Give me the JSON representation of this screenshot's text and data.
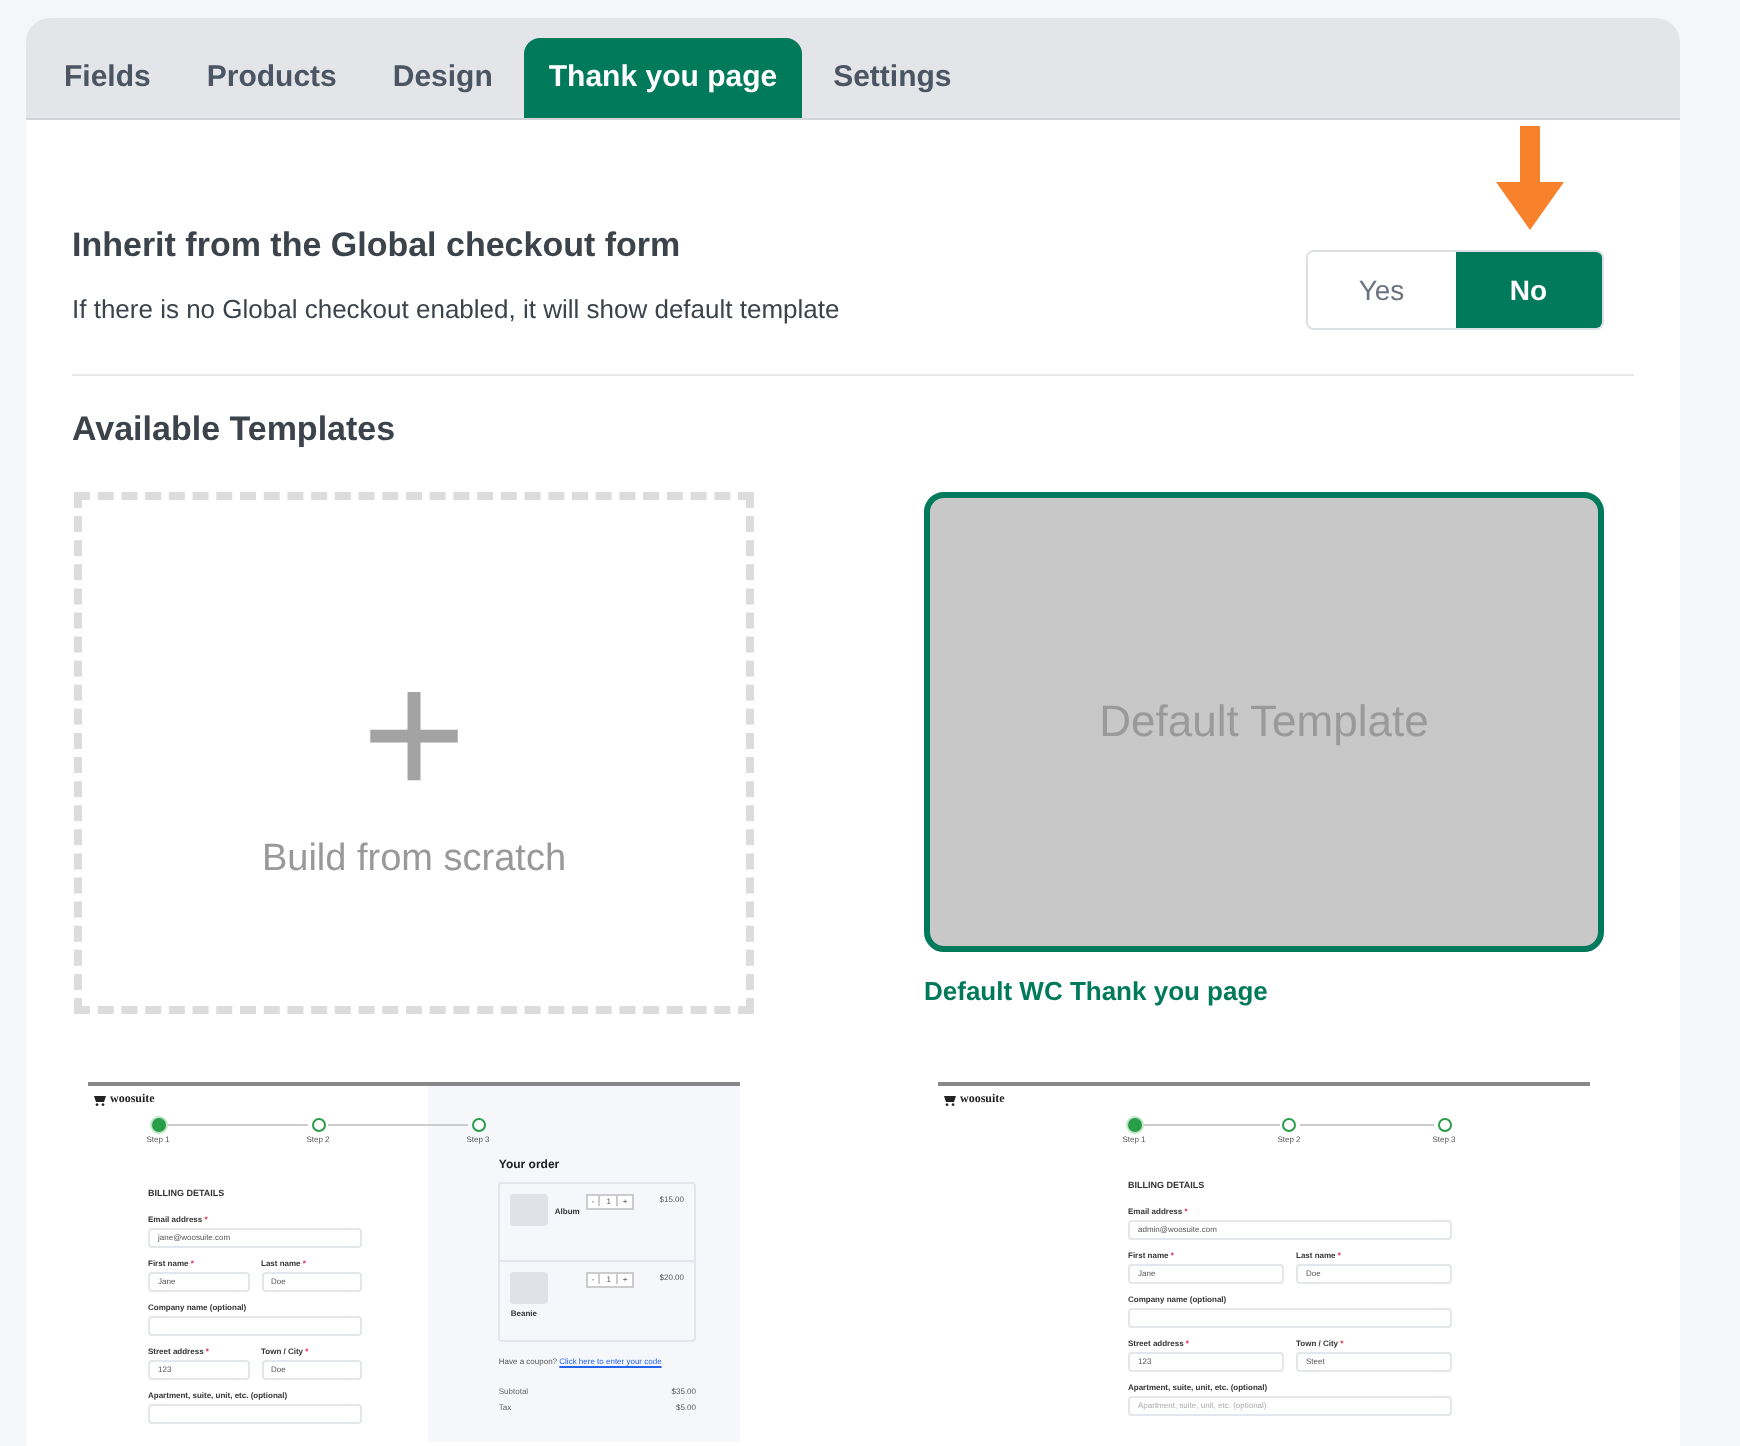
{
  "tabs": [
    {
      "label": "Fields",
      "selected": false
    },
    {
      "label": "Products",
      "selected": false
    },
    {
      "label": "Design",
      "selected": false
    },
    {
      "label": "Thank you page",
      "selected": true
    },
    {
      "label": "Settings",
      "selected": false
    }
  ],
  "inherit": {
    "title": "Inherit from the Global checkout form",
    "description": "If there is no Global checkout enabled, it will show default template",
    "options": [
      {
        "label": "Yes",
        "selected": false
      },
      {
        "label": "No",
        "selected": true
      }
    ]
  },
  "templates_title": "Available Templates",
  "templates": [
    {
      "kind": "scratch",
      "selected": false,
      "symbol": "+",
      "label": "Build from scratch"
    },
    {
      "kind": "default",
      "selected": true,
      "preview_text": "Default Template",
      "caption": "Default WC Thank you page"
    },
    {
      "kind": "preview",
      "selected": false,
      "logo": "woosuite",
      "steps": [
        {
          "label": "Step 1",
          "selected": true
        },
        {
          "label": "Step 2",
          "selected": false
        },
        {
          "label": "Step 3",
          "selected": false
        }
      ],
      "billing_title": "BILLING DETAILS",
      "rows": [
        [
          {
            "label": "Email address",
            "mark": "*",
            "value": "jane@woosuite.com"
          }
        ],
        [
          {
            "label": "First name",
            "mark": "*",
            "value": "Jane"
          },
          {
            "label": "Last name",
            "mark": "*",
            "value": "Doe"
          }
        ],
        [
          {
            "label": "Company name (optional)"
          }
        ],
        [
          {
            "label": "Street address",
            "mark": "*",
            "value": "123"
          },
          {
            "label": "Town / City",
            "mark": "*",
            "value": "Doe"
          }
        ],
        [
          {
            "label": "Apartment, suite, unit, etc. (optional)"
          }
        ]
      ],
      "order": {
        "title": "Your order",
        "items": [
          {
            "name": "Album",
            "minus": "-",
            "qty": "1",
            "plus": "+",
            "price": "$15.00"
          },
          {
            "name": "Beanie",
            "minus": "-",
            "qty": "1",
            "plus": "+",
            "price": "$20.00"
          }
        ],
        "coupon": "Have a coupon?",
        "coupon_link": "Click here to enter your code",
        "totals": [
          {
            "label": "Subtotal",
            "value": "$35.00"
          },
          {
            "label": "Tax",
            "value": "$5.00"
          }
        ]
      }
    },
    {
      "kind": "preview",
      "selected": false,
      "logo": "woosuite",
      "steps": [
        {
          "label": "Step 1",
          "selected": true
        },
        {
          "label": "Step 2",
          "selected": false
        },
        {
          "label": "Step 3",
          "selected": false
        }
      ],
      "billing_title": "BILLING DETAILS",
      "rows": [
        [
          {
            "label": "Email address",
            "mark": "*",
            "value": "admin@woosuite.com"
          }
        ],
        [
          {
            "label": "First name",
            "mark": "*",
            "value": "Jane"
          },
          {
            "label": "Last name",
            "mark": "*",
            "value": "Doe"
          }
        ],
        [
          {
            "label": "Company name (optional)"
          }
        ],
        [
          {
            "label": "Street address",
            "mark": "*",
            "value": "123"
          },
          {
            "label": "Town / City",
            "mark": "*",
            "value": "Steet"
          }
        ],
        [
          {
            "label": "Apartment, suite, unit, etc. (optional)",
            "placeholder": "Apartment, suite, unit, etc. (optional)"
          }
        ]
      ]
    }
  ]
}
